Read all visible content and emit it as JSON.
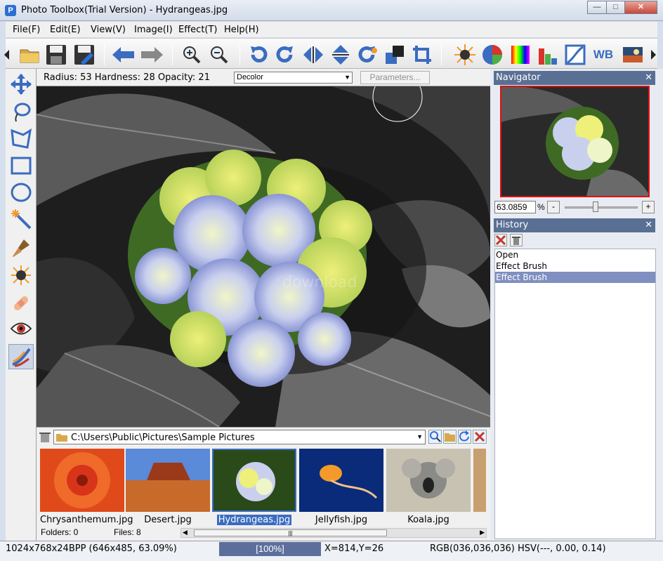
{
  "window": {
    "title": "Photo Toolbox(Trial Version) - Hydrangeas.jpg",
    "app_icon": "P",
    "minimize": "—",
    "maximize": "□",
    "close": "✕"
  },
  "menu": [
    "File(F)",
    "Edit(E)",
    "View(V)",
    "Image(I)",
    "Effect(T)",
    "Help(H)"
  ],
  "toolbar": {
    "wb_label": "WB"
  },
  "options": {
    "brush_info": "Radius: 53 Hardness: 28 Opacity: 21",
    "effect_select": "Decolor",
    "parameters_button": "Parameters..."
  },
  "canvas": {
    "watermark": "download"
  },
  "browser": {
    "path": "C:\\Users\\Public\\Pictures\\Sample Pictures",
    "thumbnails": [
      "Chrysanthemum.jpg",
      "Desert.jpg",
      "Hydrangeas.jpg",
      "Jellyfish.jpg",
      "Koala.jpg"
    ],
    "folders_label": "Folders: 0",
    "files_label": "Files: 8",
    "scroll_grip": "|||"
  },
  "navigator": {
    "title": "Navigator",
    "zoom_value": "63.0859",
    "percent": "%",
    "minus": "-",
    "plus": "+"
  },
  "history": {
    "title": "History",
    "items": [
      "Open",
      "Effect Brush",
      "Effect Brush"
    ]
  },
  "status": {
    "image_info": "1024x768x24BPP (646x485, 63.09%)",
    "zoom": "[100%]",
    "coords": "X=814,Y=26",
    "color": "RGB(036,036,036) HSV(---, 0.00, 0.14)"
  }
}
